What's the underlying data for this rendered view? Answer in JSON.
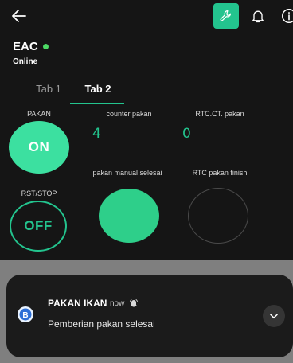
{
  "topbar": {
    "back_icon": "arrow-left-icon",
    "settings_icon": "wrench-icon",
    "notifications_icon": "bell-icon",
    "info_icon": "info-icon",
    "accent": "#23c48e"
  },
  "device": {
    "name": "EAC",
    "status": "Online",
    "status_color": "#4cd964"
  },
  "tabs": [
    {
      "label": "Tab 1",
      "active": false
    },
    {
      "label": "Tab 2",
      "active": true
    }
  ],
  "widgets": {
    "pakan_button": {
      "label": "PAKAN",
      "state": "ON"
    },
    "counter_pakan": {
      "label": "counter pakan",
      "value": "4"
    },
    "rtc_ct_pakan": {
      "label": "RTC.CT. pakan",
      "value": "0"
    },
    "pakan_manual_selesai": {
      "label": "pakan manual selesai",
      "lit": true
    },
    "rtc_pakan_finish": {
      "label": "RTC pakan finish",
      "lit": false
    },
    "rst_stop_button": {
      "label": "RST/STOP",
      "state": "OFF"
    }
  },
  "notification": {
    "app_icon": "blynk-b-icon",
    "title": "PAKAN IKAN",
    "separator": "·",
    "time": "now",
    "alert_icon": "bell-ring-icon",
    "body": "Pemberian pakan selesai",
    "expand_icon": "chevron-down-icon"
  }
}
